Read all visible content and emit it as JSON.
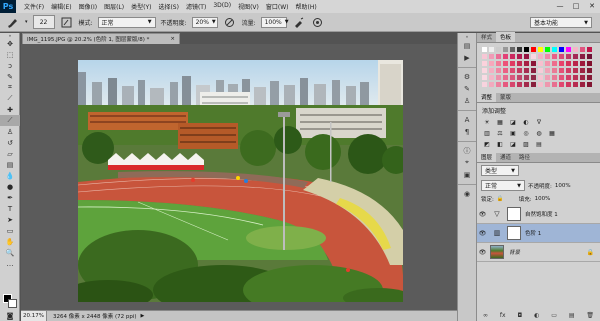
{
  "app": {
    "logo": "Ps",
    "menu": [
      "文件(F)",
      "编辑(E)",
      "图像(I)",
      "图层(L)",
      "类型(Y)",
      "选择(S)",
      "滤镜(T)",
      "3D(D)",
      "视图(V)",
      "窗口(W)",
      "帮助(H)"
    ],
    "window_controls": [
      "—",
      "□",
      "✕"
    ]
  },
  "options": {
    "brush_size": "22",
    "mode_label": "模式:",
    "mode_value": "正常",
    "opacity_label": "不透明度:",
    "opacity_value": "20%",
    "flow_label": "流量:",
    "flow_value": "100%",
    "workspace": "基本功能"
  },
  "document": {
    "tab_title": "IMG_1195.JPG @ 20.2% (色阶 1, 图层蒙版/8) *",
    "tab_close": "×",
    "zoom": "20.17%",
    "doc_info": "3264 像素 x 2448 像素 (72 ppi)",
    "status_arrow": "▶"
  },
  "panels": {
    "top_tabs": [
      "样式",
      "色板"
    ],
    "top_active": 1,
    "adj_tabs": [
      "调整",
      "蒙版"
    ],
    "adj_title": "添加调整",
    "adj_row1": [
      "☀",
      "▦",
      "◪",
      "◐",
      "∇"
    ],
    "adj_row2": [
      "▥",
      "⚖",
      "▣",
      "◎",
      "◍",
      "▦"
    ],
    "adj_row3": [
      "◩",
      "◧",
      "◪",
      "▨",
      "▤"
    ],
    "layer_tabs": [
      "图层",
      "通道",
      "路径"
    ],
    "kind_label": "类型",
    "blend_mode": "正常",
    "opacity_label": "不透明度:",
    "opacity_value": "100%",
    "lock_label": "锁定:",
    "fill_label": "填充:",
    "fill_value": "100%",
    "layers": [
      {
        "name": "自然饱和度 1",
        "icon": "▽",
        "active": false
      },
      {
        "name": "色阶 1",
        "icon": "▥",
        "active": true
      },
      {
        "name": "背景",
        "icon": "",
        "active": false
      }
    ],
    "lock_icon": "🔒",
    "footer_icons": [
      "∞",
      "fx",
      "◘",
      "◐",
      "▭",
      "▤",
      "🗑"
    ]
  },
  "swatch_colors": [
    "#ffffff",
    "#eeeeee",
    "#cccccc",
    "#999999",
    "#666666",
    "#333333",
    "#000000",
    "#ff0000",
    "#ffff00",
    "#00ff00",
    "#00ffff",
    "#0000ff",
    "#ff00ff",
    "#f5b5c8",
    "#e05580",
    "#c0154a",
    "#f7c7d5",
    "#f19ab6",
    "#ea6e97",
    "#e34177",
    "#cc2a60",
    "#b11d50",
    "#951441",
    "#f9d5e1",
    "#f4aec4",
    "#ef87a8",
    "#ea6089",
    "#d94a78",
    "#c03a67",
    "#a42a55",
    "#8a1d45",
    "#701236",
    "#fbd2dc",
    "#f7a7bb",
    "#f27d98",
    "#ed5278",
    "#e03a63",
    "#c52b53",
    "#a81f44",
    "#8c1537",
    "#f8c0cf",
    "#f396ad",
    "#ee6c8c",
    "#e9426b",
    "#d63259",
    "#bb2449",
    "#9e183b",
    "#82102e",
    "#fad7e0",
    "#f5afc2",
    "#f087a3",
    "#eb5f84",
    "#dc4a72",
    "#c33a61",
    "#a72c50",
    "#8c2040",
    "#f6ccd8",
    "#f0a3b7",
    "#ea7a96",
    "#e45175",
    "#d23d64",
    "#b93053",
    "#9d2443",
    "#821a35",
    "#f9dae3",
    "#f3b5c7",
    "#ed90ab",
    "#e76b8f",
    "#d9577e",
    "#c1476c",
    "#a7385a",
    "#8e2b49",
    "#f5c5d3",
    "#ef9fb5",
    "#e97997",
    "#e35379",
    "#d34068",
    "#ba3257",
    "#9f2546",
    "#851b37",
    "#f8d3de",
    "#f2aabe",
    "#ec819e",
    "#e6587e",
    "#d7456d",
    "#be365c",
    "#a32a4b",
    "#891f3c",
    "#f4bfcd",
    "#ee97ae",
    "#e86f8f",
    "#e24770",
    "#d0375f",
    "#b72a4f",
    "#9c1f40",
    "#821633"
  ]
}
